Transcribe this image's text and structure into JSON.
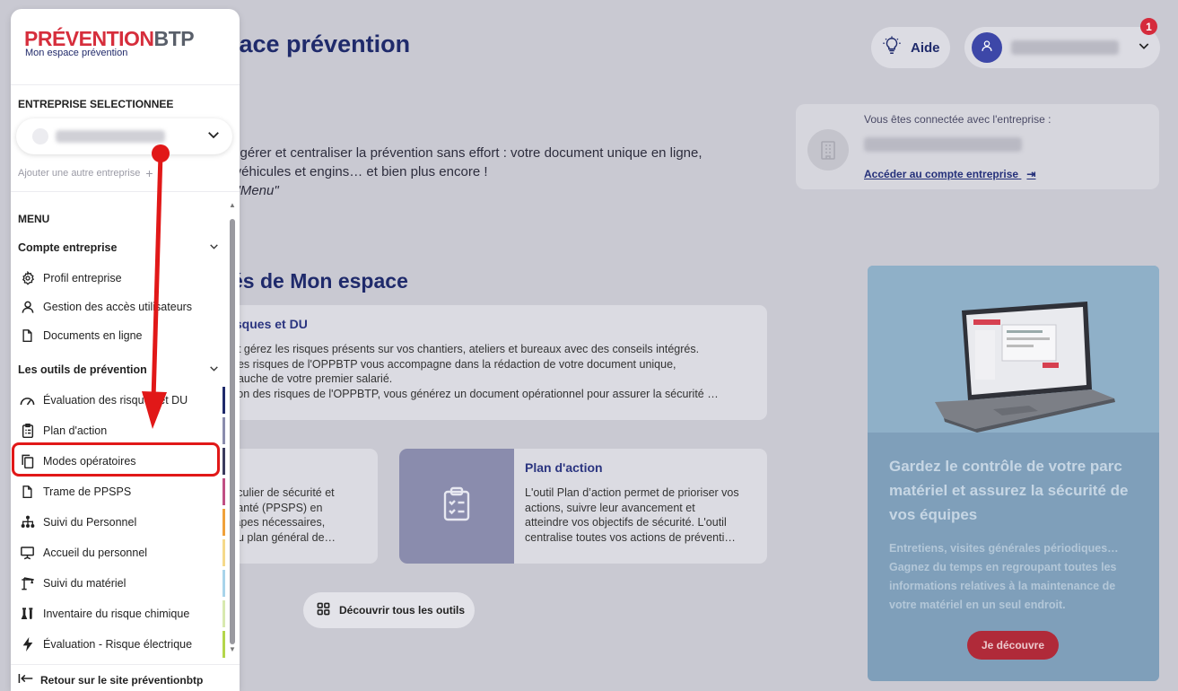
{
  "header": {
    "title_partial": "pace prévention",
    "aide_label": "Aide",
    "notification_count": "1"
  },
  "intro": {
    "line1": "ur gérer et centraliser la prévention sans effort : votre document unique en ligne,",
    "line2": "s véhicules et engins… et bien plus encore !",
    "line3": "e \"Menu\""
  },
  "connected": {
    "label": "Vous êtes connectée avec l'entreprise :",
    "link": "Accéder au compte entreprise"
  },
  "section": {
    "title": "és de Mon espace"
  },
  "cards": {
    "risques": {
      "title": "isques et DU",
      "lines": [
        "et gérez les risques présents sur vos chantiers, ateliers et bureaux avec des conseils intégrés.",
        "des risques de l'OPPBTP vous accompagne dans la rédaction de votre document unique,",
        "bauche de votre premier salarié.",
        "tion des risques de l'OPPBTP, vous générez un document opérationnel pour assurer la sécurité …"
      ]
    },
    "modes": {
      "lines": [
        "ticulier de sécurité et",
        "santé (PPSPS) en",
        "tapes nécessaires,",
        "du plan général de…"
      ]
    },
    "plan": {
      "title": "Plan d'action",
      "lines": [
        "L'outil Plan d’action permet de prioriser vos",
        "actions, suivre leur avancement et",
        "atteindre vos objectifs de sécurité. L'outil",
        "centralise toutes vos actions de préventi…"
      ]
    }
  },
  "discover_label": "Découvrir tous les outils",
  "promo": {
    "title": "Gardez le contrôle de votre parc matériel et assurez la sécurité de vos équipes",
    "text": "Entretiens, visites générales périodiques… Gagnez du temps en regroupant toutes les informations relatives à la maintenance de votre matériel en un seul endroit.",
    "button": "Je découvre"
  },
  "sidebar": {
    "logo_red": "PRÉVENTION",
    "logo_dark": "BTP",
    "logo_sub": "Mon espace prévention",
    "entreprise_label": "ENTREPRISE SELECTIONNEE",
    "add_entreprise": "Ajouter une autre entreprise",
    "menu_label": "MENU",
    "group_compte": "Compte entreprise",
    "compte_items": [
      {
        "label": "Profil entreprise",
        "icon": "gear-icon"
      },
      {
        "label": "Gestion des accès utilisateurs",
        "icon": "user-icon"
      },
      {
        "label": "Documents en ligne",
        "icon": "document-icon"
      }
    ],
    "group_outils": "Les outils de prévention",
    "outils_items": [
      {
        "label": "Évaluation des risques et DU",
        "icon": "gauge-icon",
        "color": "#1f2a6b"
      },
      {
        "label": "Plan d'action",
        "icon": "clipboard-icon",
        "color": "#8a8cad"
      },
      {
        "label": "Modes opératoires",
        "icon": "copy-icon",
        "color": "#3b3b5e"
      },
      {
        "label": "Trame de PPSPS",
        "icon": "document-icon",
        "color": "#c04f84"
      },
      {
        "label": "Suivi du Personnel",
        "icon": "org-chart-icon",
        "color": "#f0a13a"
      },
      {
        "label": "Accueil du personnel",
        "icon": "presentation-icon",
        "color": "#f5d98a"
      },
      {
        "label": "Suivi du matériel",
        "icon": "crane-icon",
        "color": "#a8d4ea"
      },
      {
        "label": "Inventaire du risque chimique",
        "icon": "flask-icon",
        "color": "#d8e9b0"
      },
      {
        "label": "Évaluation - Risque électrique",
        "icon": "lightning-icon",
        "color": "#b4d64a"
      }
    ],
    "retour": "Retour sur le site préventionbtp"
  },
  "colors": {
    "brand_red": "#d62e3c",
    "brand_navy": "#1f2a6b",
    "annotation_red": "#e11818"
  }
}
